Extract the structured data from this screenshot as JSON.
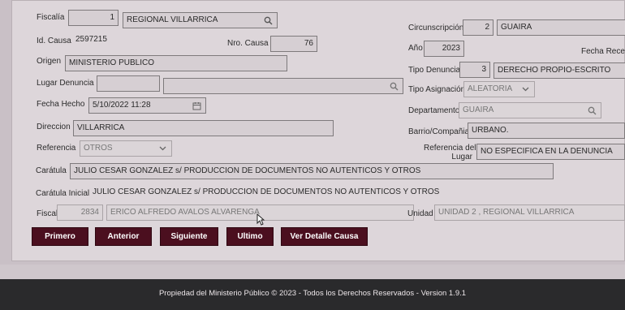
{
  "left": {
    "fiscalia_label": "Fiscalía",
    "fiscalia_num": "1",
    "fiscalia_name": "REGIONAL VILLARRICA",
    "idcausa_label": "Id. Causa",
    "idcausa_value": "2597215",
    "nrocausa_label": "Nro. Causa",
    "nrocausa_value": "76",
    "origen_label": "Origen",
    "origen_value": "MINISTERIO PUBLICO",
    "lugar_label": "Lugar Denuncia",
    "lugar_code": "",
    "lugar_value": "",
    "fecha_label": "Fecha Hecho",
    "fecha_value": "5/10/2022 11:28",
    "direccion_label": "Direccion",
    "direccion_value": "VILLARRICA",
    "referencia_label": "Referencia",
    "referencia_value": "OTROS",
    "caratula_label": "Carátula",
    "caratula_value": "JULIO CESAR GONZALEZ s/ PRODUCCION DE DOCUMENTOS NO AUTENTICOS Y OTROS",
    "caratula_inicial_label": "Carátula Inicial",
    "caratula_inicial_value": "JULIO CESAR GONZALEZ s/ PRODUCCION DE DOCUMENTOS NO AUTENTICOS Y OTROS",
    "fiscal_label": "Fiscal",
    "fiscal_code": "2834",
    "fiscal_name": "ERICO ALFREDO AVALOS ALVARENGA"
  },
  "right": {
    "circ_label": "Circunscripción",
    "circ_num": "2",
    "circ_name": "GUAIRA",
    "anio_label": "Año",
    "anio_value": "2023",
    "fecha_recep_label": "Fecha Recepc",
    "tipo_denuncia_label": "Tipo Denuncia",
    "tipo_denuncia_num": "3",
    "tipo_denuncia_value": "DERECHO PROPIO-ESCRITO",
    "tipo_asig_label": "Tipo Asignación",
    "tipo_asig_value": "ALEATORIA",
    "depto_label": "Departamento",
    "depto_value": "GUAIRA",
    "barrio_label": "Barrio/Compañia",
    "barrio_value": "URBANO.",
    "ref_lugar_label_1": "Referencia del",
    "ref_lugar_label_2": "Lugar",
    "ref_lugar_value": "NO ESPECIFICA EN LA DENUNCIA",
    "unidad_label": "Unidad",
    "unidad_value": "UNIDAD 2 , REGIONAL VILLARRICA"
  },
  "buttons": {
    "primero": "Primero",
    "anterior": "Anterior",
    "siguiente": "Siguiente",
    "ultimo": "Ultimo",
    "detalle": "Ver Detalle Causa"
  },
  "footer": "Propiedad del Ministerio Público © 2023 - Todos los Derechos Reservados - Version 1.9.1"
}
